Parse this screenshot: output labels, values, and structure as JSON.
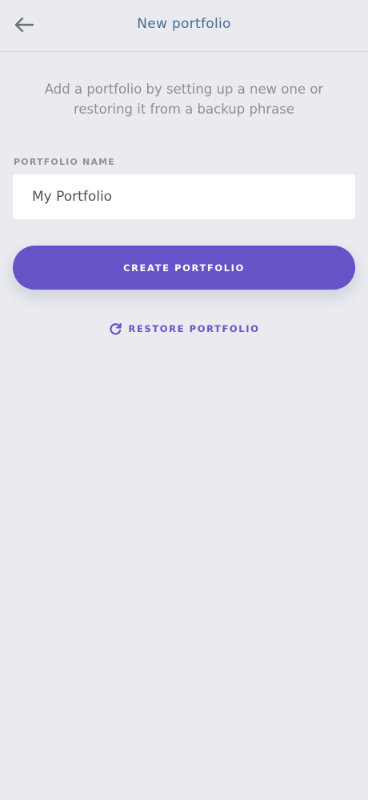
{
  "header": {
    "title": "New portfolio",
    "back_icon": "arrow-left-icon"
  },
  "intro": {
    "text": "Add a portfolio by setting up a new one or restoring it from a backup phrase"
  },
  "form": {
    "name_label": "PORTFOLIO NAME",
    "name_value": "My Portfolio"
  },
  "actions": {
    "create_label": "CREATE PORTFOLIO",
    "restore_label": "RESTORE PORTFOLIO",
    "restore_icon": "refresh-icon"
  },
  "colors": {
    "accent": "#6752c7",
    "title": "#4a6b94",
    "background": "#e9ebf0"
  }
}
